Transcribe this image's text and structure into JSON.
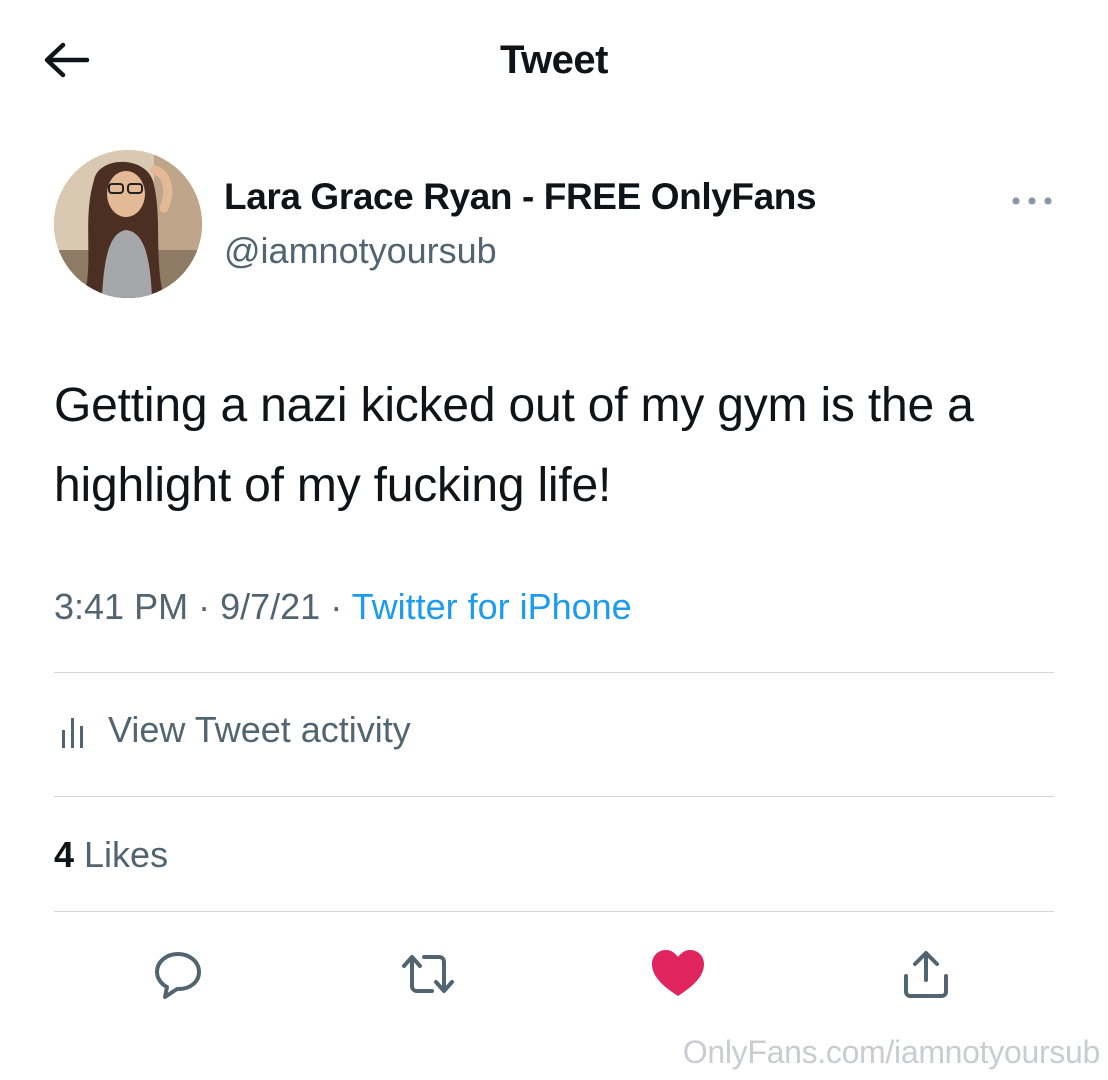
{
  "header": {
    "title": "Tweet",
    "back_icon": "arrow-left-icon"
  },
  "author": {
    "display_name": "Lara Grace Ryan - FREE OnlyFans",
    "handle": "@iamnotyoursub",
    "avatar_icon": "avatar-photo"
  },
  "tweet": {
    "text": "Getting a nazi kicked out of my gym is the a highlight of my fucking life!",
    "time": "3:41 PM",
    "date": "9/7/21",
    "separator": "·",
    "source": "Twitter for iPhone"
  },
  "activity": {
    "label": "View Tweet activity",
    "icon": "bar-chart-icon"
  },
  "likes": {
    "count": "4",
    "label": "Likes"
  },
  "actions": [
    {
      "name": "reply",
      "icon": "reply-bubble-icon"
    },
    {
      "name": "retweet",
      "icon": "retweet-icon"
    },
    {
      "name": "like",
      "icon": "heart-filled-icon"
    },
    {
      "name": "share",
      "icon": "share-icon"
    }
  ],
  "colors": {
    "text_primary": "#0f1419",
    "text_secondary": "#536471",
    "link": "#1d9bf0",
    "like": "#e0245e",
    "divider": "#cfd9de",
    "watermark": "#c9ccd0"
  },
  "watermark": "OnlyFans.com/iamnotyoursub"
}
